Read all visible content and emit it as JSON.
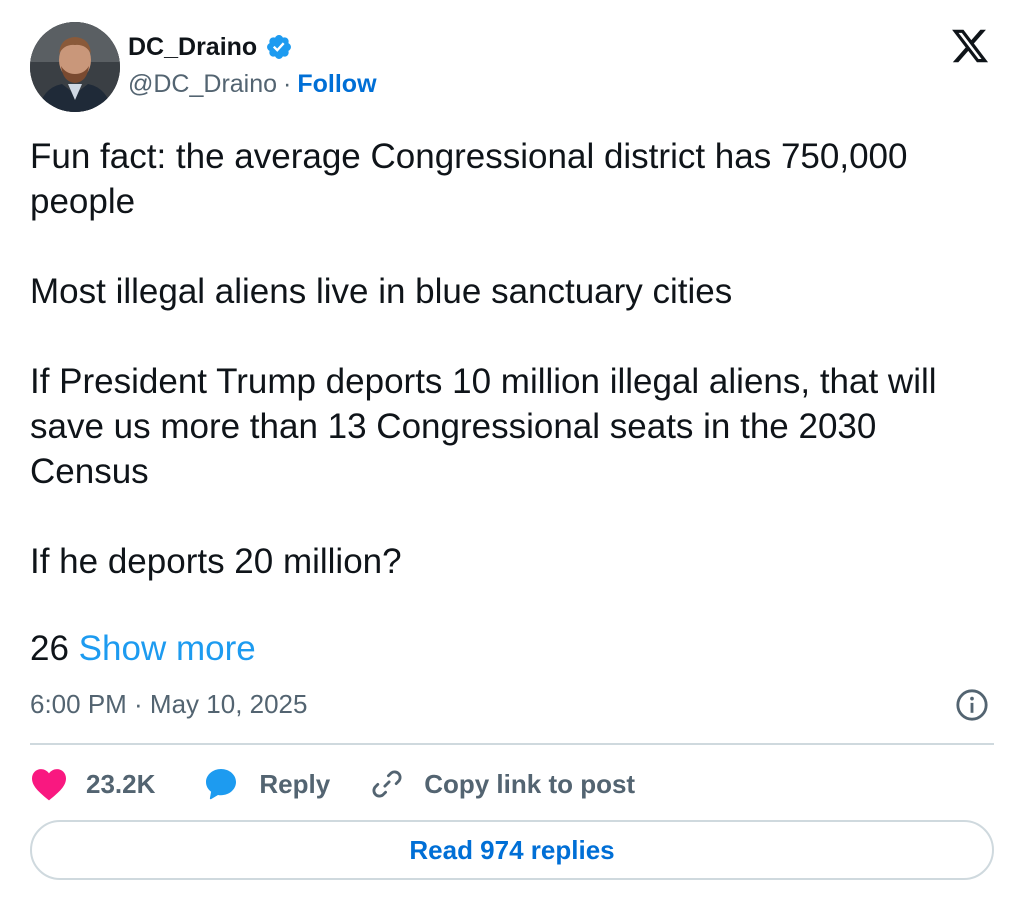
{
  "author": {
    "display_name": "DC_Draino",
    "handle": "@DC_Draino",
    "separator": "·",
    "follow_label": "Follow"
  },
  "post": {
    "paragraphs": [
      "Fun fact: the average Congressional district has 750,000 people",
      "Most illegal aliens live in blue sanctuary cities",
      "If President Trump deports 10 million illegal aliens, that will save us more than 13 Congressional seats in the 2030 Census",
      "If he deports 20 million?"
    ],
    "more_prefix": "26",
    "show_more_label": "Show more",
    "timestamp": "6:00 PM · May 10, 2025"
  },
  "actions": {
    "like_count": "23.2K",
    "reply_label": "Reply",
    "copy_link_label": "Copy link to post"
  },
  "footer": {
    "read_replies_label": "Read 974 replies"
  },
  "colors": {
    "link": "#006fd6",
    "show_more": "#1d9bf0",
    "like": "#f91880",
    "reply": "#1d9bf0",
    "verified": "#1d9bf0",
    "muted": "#536471",
    "border": "#cfd9de"
  },
  "icons": {
    "verified": "verified-badge-icon",
    "brand": "x-logo-icon",
    "info": "info-icon",
    "like": "heart-icon",
    "reply": "speech-bubble-icon",
    "copy": "link-icon"
  }
}
